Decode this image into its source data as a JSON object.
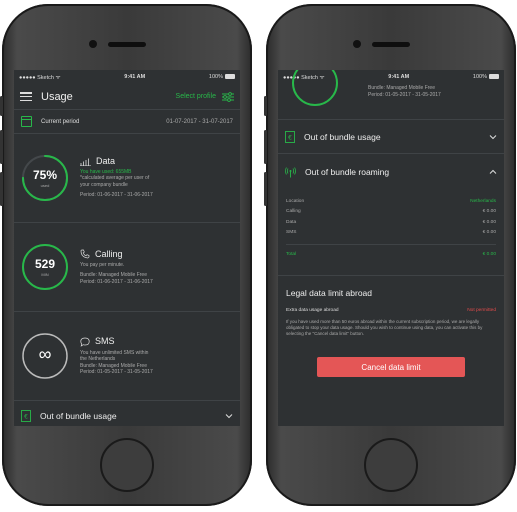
{
  "colors": {
    "accent": "#28b84a",
    "danger": "#e45656",
    "screen_bg": "#2e3133"
  },
  "left": {
    "status": {
      "carrier": "●●●●● Sketch ᯤ",
      "time": "9:41 AM",
      "battery": "100%"
    },
    "nav": {
      "title": "Usage",
      "select_profile": "Select profile"
    },
    "period": {
      "label": "Current period",
      "value": "01-07-2017 - 31-07-2017"
    },
    "data_card": {
      "value": "75%",
      "unit": "used",
      "progress": 0.75,
      "title": "Data",
      "line1": "You have used: 655MB",
      "line2": "*calculated average per user of",
      "line3": "your company bundle",
      "line4": "Period: 01-06-2017 - 31-06-2017"
    },
    "calling_card": {
      "value": "529",
      "unit": "MIN",
      "title": "Calling",
      "line1": "You pay per minute.",
      "line2": "Bundle: Managed Mobile Free",
      "line3": "Period: 01-06-2017 - 31-06-2017"
    },
    "sms_card": {
      "value": "∞",
      "title": "SMS",
      "line1": "You have unlimited SMS within",
      "line2": "the Netherlands",
      "line3": "Bundle: Managed Mobile Free",
      "line4": "Period: 01-05-2017 - 31-05-2017"
    },
    "bundle_row": {
      "label": "Out of bundle usage"
    }
  },
  "right": {
    "status": {
      "carrier": "●●●●● Sketch ᯤ",
      "time": "9:41 AM",
      "battery": "100%"
    },
    "top": {
      "line1": "Bundle: Managed Mobile Free",
      "line2": "Period: 01-05-2017 - 31-05-2017"
    },
    "bundle_row": {
      "label": "Out of bundle usage"
    },
    "roaming_row": {
      "label": "Out of bundle roaming"
    },
    "roaming_table": {
      "header": {
        "label": "Location",
        "value": "Netherlands"
      },
      "rows": [
        {
          "label": "Calling",
          "value": "€ 0.00"
        },
        {
          "label": "Data",
          "value": "€ 0.00"
        },
        {
          "label": "SMS",
          "value": "€ 0.00"
        }
      ],
      "total": {
        "label": "Total",
        "value": "€ 0.00"
      }
    },
    "legal": {
      "title": "Legal data limit abroad",
      "row_label": "Extra data usage abroad",
      "row_value": "Not permitted",
      "text": "If you have used more than 50 euros abroad within the current subscription period, we are legally obligated to stop your data usage. Should you wish to continue using data, you can activate this by selecting the \"Cancel data limit\" button.",
      "button": "Cancel data limit"
    }
  }
}
